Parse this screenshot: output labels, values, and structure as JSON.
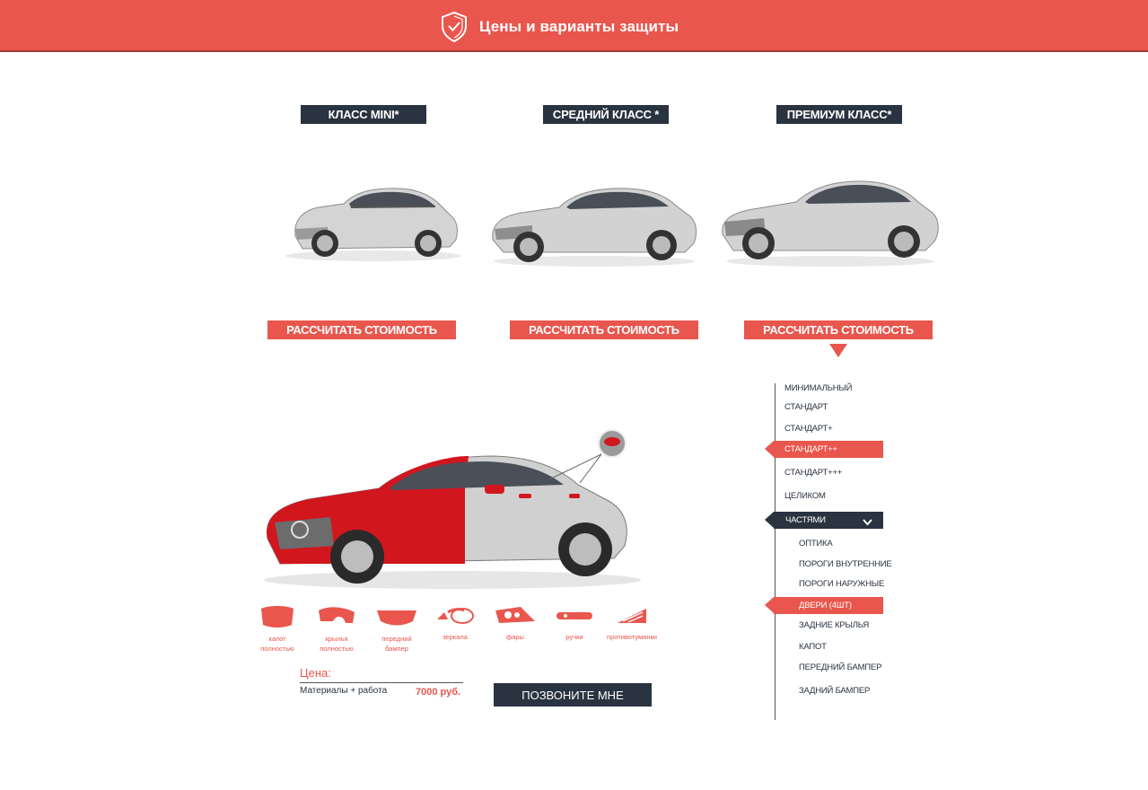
{
  "header": {
    "title": "Цены и варианты защиты",
    "icon": "shield-check-icon"
  },
  "classes": [
    {
      "label": "КЛАСС MINI*",
      "button": "РАССЧИТАТЬ СТОИМОСТЬ"
    },
    {
      "label": "СРЕДНИЙ КЛАСС *",
      "button": "РАССЧИТАТЬ СТОИМОСТЬ"
    },
    {
      "label": "ПРЕМИУМ КЛАСС*",
      "button": "РАССЧИТАТЬ СТОИМОСТЬ"
    }
  ],
  "parts": [
    {
      "label": "капот\nполностью",
      "icon": "hood-icon"
    },
    {
      "label": "крылья\nполностью",
      "icon": "fender-icon"
    },
    {
      "label": "передний\nбампер",
      "icon": "front-bumper-icon"
    },
    {
      "label": "зеркала",
      "icon": "mirror-icon"
    },
    {
      "label": "фары",
      "icon": "headlight-icon"
    },
    {
      "label": "ручки",
      "icon": "door-handle-icon"
    },
    {
      "label": "противотуманки",
      "icon": "fog-light-icon"
    }
  ],
  "price": {
    "title": "Цена:",
    "desc": "Материалы + работа",
    "value": "7000 руб."
  },
  "call_button": "ПОЗВОНИТЕ МНЕ",
  "menu": {
    "items": [
      "МИНИМАЛЬНЫЙ",
      "СТАНДАРТ",
      "СТАНДАРТ+",
      "СТАНДАРТ++",
      "СТАНДАРТ+++",
      "ЦЕЛИКОМ",
      "ЧАСТЯМИ"
    ],
    "subitems": [
      "ОПТИКА",
      "ПОРОГИ ВНУТРЕННИЕ",
      "ПОРОГИ НАРУЖНЫЕ",
      "ДВЕРИ (4ШТ)",
      "ЗАДНИЕ КРЫЛЬЯ",
      "КАПОТ",
      "ПЕРЕДНИЙ БАМПЕР",
      "ЗАДНИЙ БАМПЕР"
    ]
  },
  "colors": {
    "accent": "#e9564d",
    "dark": "#2a3340"
  }
}
